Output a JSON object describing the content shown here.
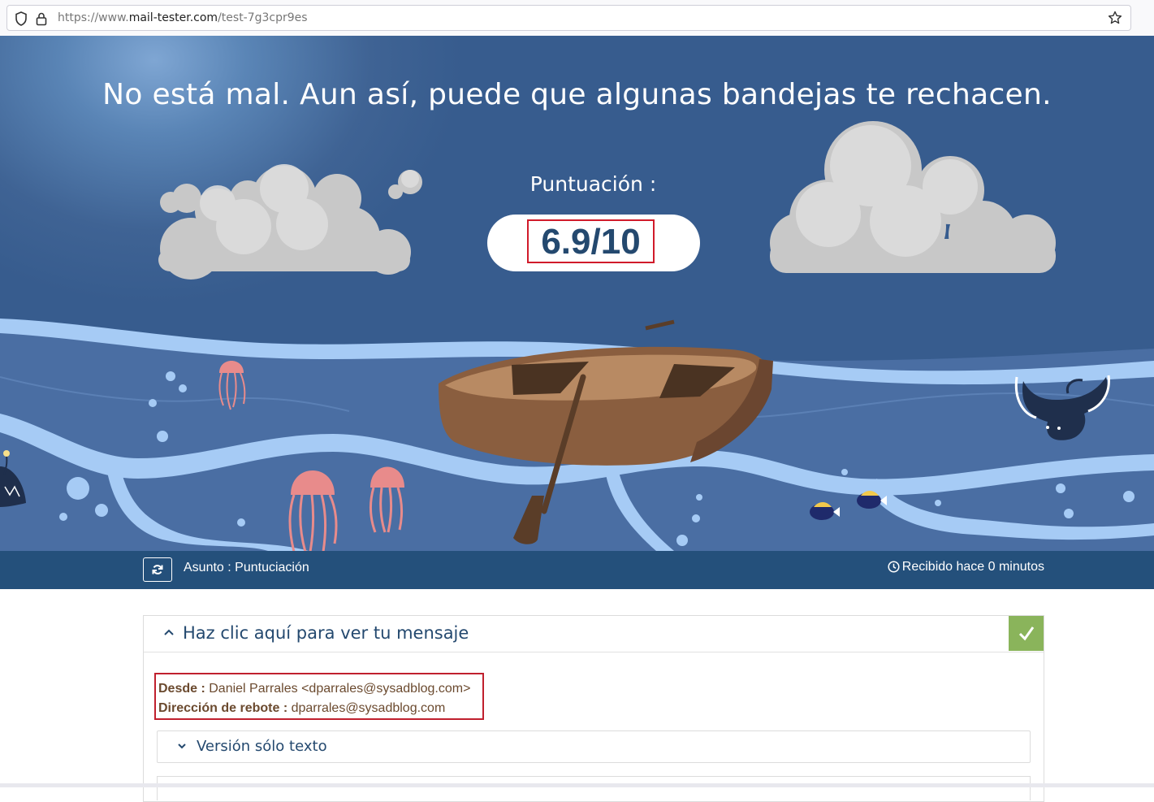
{
  "browser": {
    "url_prefix": "https://www.",
    "url_host": "mail-tester.com",
    "url_path": "/test-7g3cpr9es"
  },
  "hero": {
    "title": "No está mal. Aun así, puede que algunas bandejas te rechacen.",
    "score_label": "Puntuación :",
    "score_value": "6.9/10"
  },
  "info_bar": {
    "subject": "Asunto : Puntuciación",
    "received": "Recibido hace 0 minutos"
  },
  "message_panel": {
    "title": "Haz clic aquí para ver tu mensaje",
    "from_label": "Desde :",
    "from_value": "Daniel Parrales <dparrales@sysadblog.com>",
    "bounce_label": "Dirección de rebote :",
    "bounce_value": "dparrales@sysadblog.com",
    "text_version_title": "Versión sólo texto"
  },
  "colors": {
    "sky": "#375c8e",
    "sea": "#4a6ea3",
    "wave": "#a6cbf5",
    "info_bar": "#24507b",
    "score_text": "#24496f",
    "highlight": "#d11b2a",
    "check_ok": "#8ab45b"
  },
  "icons": [
    "shield-icon",
    "lock-icon",
    "star-icon",
    "refresh-icon",
    "clock-icon",
    "chevron-up-icon",
    "check-icon",
    "chevron-down-icon"
  ]
}
